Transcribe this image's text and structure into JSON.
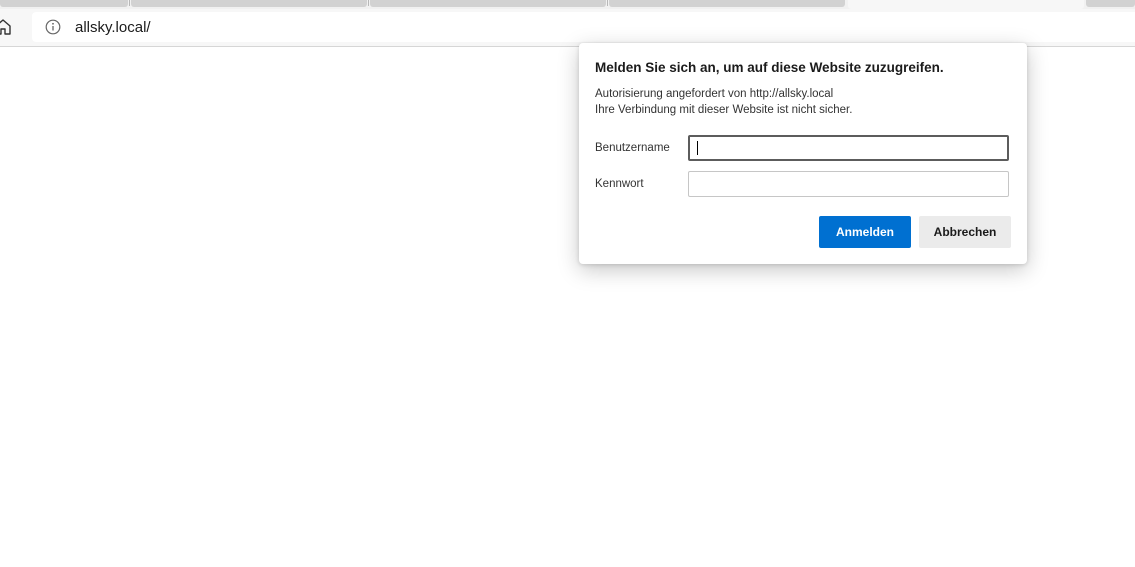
{
  "browser": {
    "url": "allsky.local/",
    "home_icon": "home-icon",
    "site_info_icon": "info-circle-icon"
  },
  "dialog": {
    "title": "Melden Sie sich an, um auf diese Website zuzugreifen.",
    "line1": "Autorisierung angefordert von http://allsky.local",
    "line2": "Ihre Verbindung mit dieser Website ist nicht sicher.",
    "username_label": "Benutzername",
    "username_value": "",
    "password_label": "Kennwort",
    "password_value": "",
    "signin_label": "Anmelden",
    "cancel_label": "Abbrechen",
    "primary_color": "#0070d1"
  }
}
